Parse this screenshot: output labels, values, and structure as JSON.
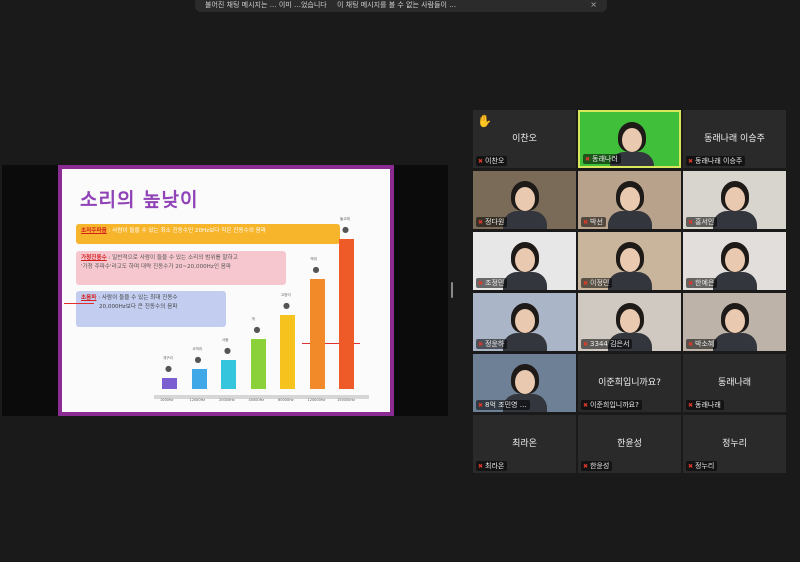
{
  "notification": {
    "left_text": "불어진 채팅 메시지는 … 이미 …었습니다",
    "mid_text": "이 채팅 메시지를 볼 수 없는 사람들이 …",
    "close": "×"
  },
  "slide": {
    "title": "소리의 높낮이",
    "box1_term": "초저주파음",
    "box1_text": ": 사람이 들을 수 있는 최소 진동수인 20Hz보다 작은 진동수의 음파",
    "box2_term": "가청진동수",
    "box2_text": ": 일반적으로 사람이 들을 수 있는 소리의 범위를 말하고",
    "box2_text2": "'가청 주파수'라고도 하며 대략 진동수가 20~20,000Hz인 음파",
    "box3_term": "초음파",
    "box3_text": ": 사람이 들을 수 있는 최대 진동수",
    "box3_text2": "20,000Hz보다 큰 진동수의 음파",
    "bars": [
      {
        "label": "1000Hz",
        "animal": "개구리",
        "color": "#7b5fd1",
        "level": 0.07
      },
      {
        "label": "12000Hz",
        "animal": "코끼리",
        "color": "#41a8e8",
        "level": 0.13
      },
      {
        "label": "20000Hz",
        "animal": "사람",
        "color": "#35c6de",
        "level": 0.19
      },
      {
        "label": "40000Hz",
        "animal": "개",
        "color": "#8bd13a",
        "level": 0.33
      },
      {
        "label": "60000Hz",
        "animal": "고양이",
        "color": "#f6c21d",
        "level": 0.49
      },
      {
        "label": "120000Hz",
        "animal": "박쥐",
        "color": "#f28a2a",
        "level": 0.73
      },
      {
        "label": "150000Hz",
        "animal": "돌고래",
        "color": "#ef5b28",
        "level": 1.0
      }
    ]
  },
  "participants": [
    {
      "big_name": "이찬오",
      "name": "이찬오",
      "video": false,
      "hand": true,
      "active": false
    },
    {
      "big_name": "",
      "name": "동래나러",
      "video": true,
      "hand": false,
      "active": true,
      "bg": "#3fbf3a"
    },
    {
      "big_name": "동래나래 이승주",
      "name": "동래나래 이승주",
      "video": false,
      "hand": false,
      "active": false
    },
    {
      "big_name": "",
      "name": "정다원",
      "video": true,
      "bg": "#7a6a58"
    },
    {
      "big_name": "",
      "name": "박선",
      "video": true,
      "bg": "#b9a28c"
    },
    {
      "big_name": "",
      "name": "홍서인",
      "video": true,
      "bg": "#d8d4ce"
    },
    {
      "big_name": "",
      "name": "조정민",
      "video": true,
      "bg": "#e7e7e7"
    },
    {
      "big_name": "",
      "name": "이정민",
      "video": true,
      "bg": "#c9b59c"
    },
    {
      "big_name": "",
      "name": "한예은",
      "video": true,
      "bg": "#e2dedb"
    },
    {
      "big_name": "",
      "name": "정윤하",
      "video": true,
      "bg": "#aab6c8"
    },
    {
      "big_name": "",
      "name": "3344 김은서",
      "video": true,
      "bg": "#cfc9c2"
    },
    {
      "big_name": "",
      "name": "박소혜",
      "video": true,
      "bg": "#bdb3a8"
    },
    {
      "big_name": "",
      "name": "8억 조민영 …",
      "video": true,
      "bg": "#6d8096"
    },
    {
      "big_name": "이준희입니까요?",
      "name": "이준희입니까요?",
      "video": false
    },
    {
      "big_name": "동래나래",
      "name": "동래나래",
      "video": false
    },
    {
      "big_name": "최라온",
      "name": "최라온",
      "video": false
    },
    {
      "big_name": "한윤성",
      "name": "한윤성",
      "video": false
    },
    {
      "big_name": "정누리",
      "name": "정누리",
      "video": false
    }
  ]
}
